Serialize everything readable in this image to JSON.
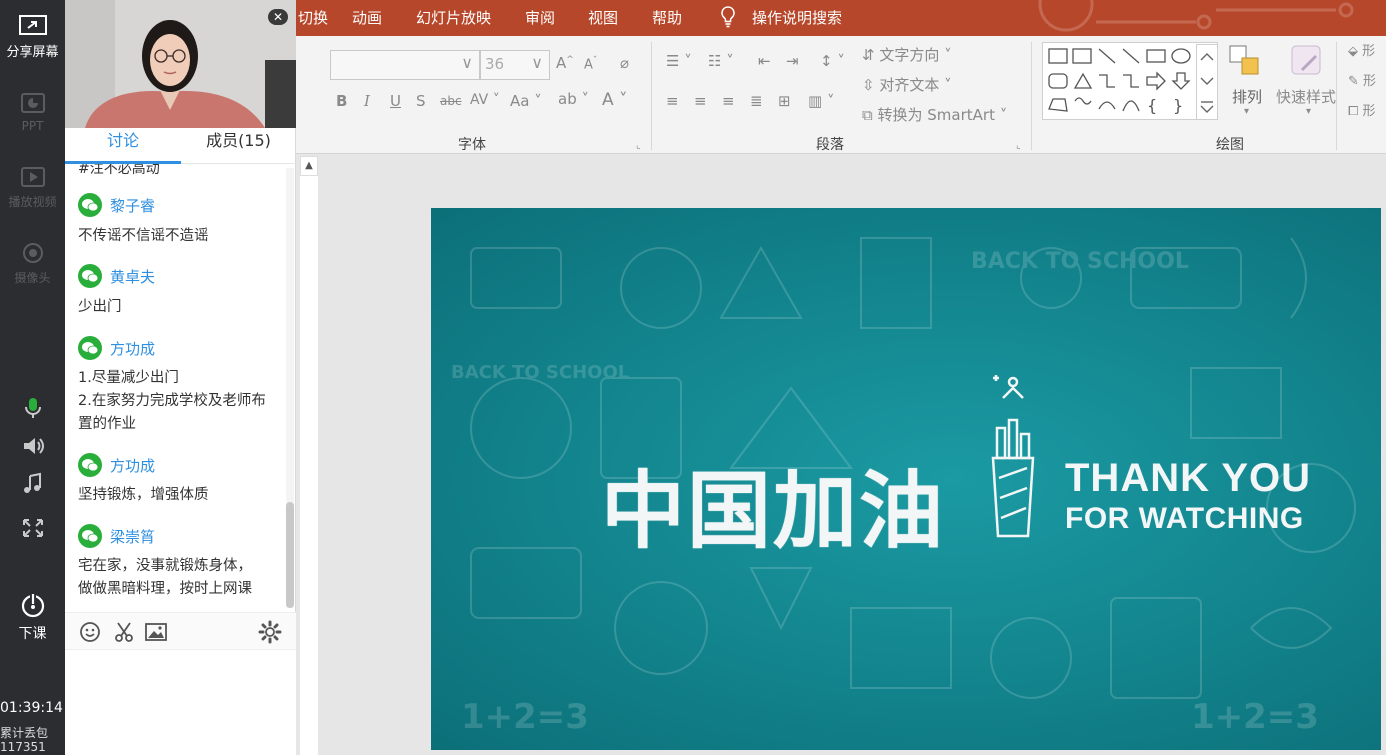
{
  "ppt": {
    "menu": [
      "切换",
      "动画",
      "幻灯片放映",
      "审阅",
      "视图",
      "帮助"
    ],
    "tell_me": "操作说明搜索",
    "ribbon": {
      "font_group_label": "字体",
      "paragraph_group_label": "段落",
      "drawing_group_label": "绘图",
      "font_size": "36",
      "text_direction": "文字方向",
      "align_text": "对齐文本",
      "convert_smartart": "转换为 SmartArt",
      "arrange": "排列",
      "quick_styles": "快速样式"
    },
    "slide": {
      "title_cn": "中国加油",
      "thanks": "THANK YOU",
      "watching": "FOR WATCHING"
    }
  },
  "toolbar": {
    "share_screen": "分享屏幕",
    "ppt": "PPT",
    "play_video": "播放视频",
    "camera": "摄像头",
    "end_class": "下课",
    "time": "01:39:14",
    "packet_loss_label": "累计丢包",
    "packet_loss_value": "117351"
  },
  "chat": {
    "tabs": {
      "discuss": "讨论",
      "members": "成员(15)"
    },
    "cut_off_text": "#注不必高动",
    "messages": [
      {
        "name": "黎子睿",
        "lines": [
          "不传谣不信谣不造谣"
        ]
      },
      {
        "name": "黄卓夫",
        "lines": [
          "少出门"
        ]
      },
      {
        "name": "方功成",
        "lines": [
          "1.尽量减少出门",
          "2.在家努力完成学校及老师布",
          "置的作业"
        ]
      },
      {
        "name": "方功成",
        "lines": [
          "坚持锻炼，增强体质"
        ]
      },
      {
        "name": "梁崇筲",
        "lines": [
          "宅在家，没事就锻炼身体，",
          "做做黑暗料理，按时上网课"
        ]
      }
    ]
  },
  "colors": {
    "ppt_accent": "#b7472a",
    "chat_accent": "#2f8fe0",
    "slide_bg": "#12838c",
    "wechat_green": "#2aae3b"
  }
}
